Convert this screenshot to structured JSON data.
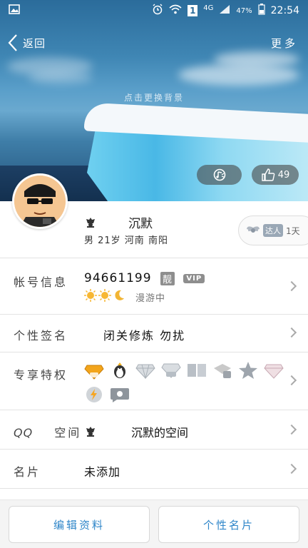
{
  "status_bar": {
    "network": "4G",
    "sim": "1",
    "battery": "47%",
    "time": "22:54"
  },
  "nav": {
    "back_label": "返回",
    "more_label": "更多",
    "bg_hint": "点击更换背景"
  },
  "hero": {
    "like_count": "49"
  },
  "profile": {
    "name": "沉默",
    "details": "男  21岁  河南  南阳",
    "daren_badge": "达人",
    "daren_days": "1天"
  },
  "rows": {
    "account_label": "帐号信息",
    "qq_number": "94661199",
    "liang_tag": "靓",
    "vip_tag": "VIP",
    "roaming": "漫游中",
    "signature_label": "个性签名",
    "signature_value": "闭关修炼  勿扰",
    "privilege_label": "专享特权",
    "qzone_label_1": "QQ",
    "qzone_label_2": "空间",
    "qzone_value": "沉默的空间",
    "card_label": "名片",
    "card_value": "未添加"
  },
  "bottom": {
    "edit_label": "编辑资料",
    "card_label": "个性名片"
  },
  "colors": {
    "accent": "#2f86c9"
  }
}
